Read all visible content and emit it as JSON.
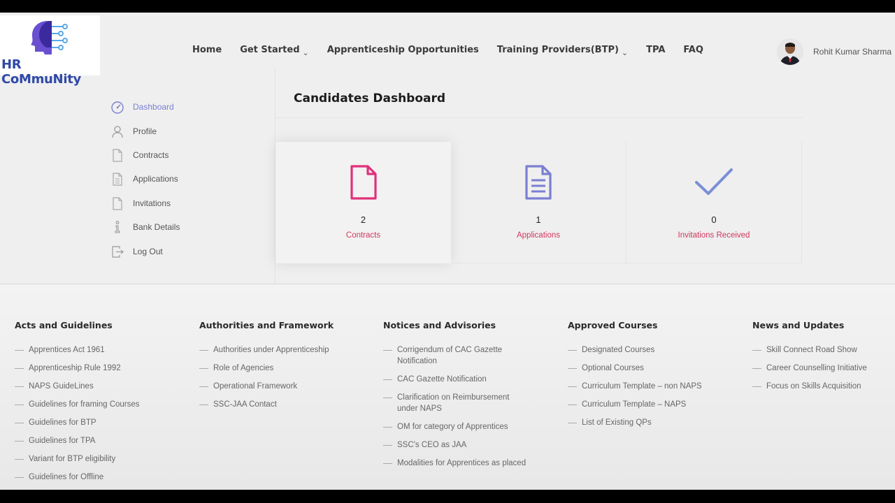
{
  "brand": {
    "name_parts": [
      {
        "text": "HR ",
        "color": "#2f49a8"
      },
      {
        "text": "CoMmuNity",
        "color": "#2f49a8"
      }
    ],
    "accent": "#5a3fc0"
  },
  "nav": {
    "items": [
      {
        "label": "Home",
        "dropdown": false
      },
      {
        "label": "Get Started",
        "dropdown": true
      },
      {
        "label": "Apprenticeship Opportunities",
        "dropdown": false
      },
      {
        "label": "Training Providers(BTP)",
        "dropdown": true
      },
      {
        "label": "TPA",
        "dropdown": false
      },
      {
        "label": "FAQ",
        "dropdown": false
      }
    ],
    "caret": "⌄"
  },
  "user": {
    "name": "Rohit Kumar Sharma"
  },
  "sidebar": {
    "items": [
      {
        "label": "Dashboard",
        "icon": "dashboard-gauge-icon",
        "active": true
      },
      {
        "label": "Profile",
        "icon": "user-icon",
        "active": false
      },
      {
        "label": "Contracts",
        "icon": "document-icon",
        "active": false
      },
      {
        "label": "Applications",
        "icon": "document-lines-icon",
        "active": false
      },
      {
        "label": "Invitations",
        "icon": "document-icon",
        "active": false
      },
      {
        "label": "Bank Details",
        "icon": "info-icon",
        "active": false
      },
      {
        "label": "Log Out",
        "icon": "logout-icon",
        "active": false
      }
    ]
  },
  "dashboard": {
    "title": "Candidates Dashboard",
    "cards": [
      {
        "count": "2",
        "label": "Contracts",
        "icon": "contract-document-icon",
        "icon_color": "#e0317b"
      },
      {
        "count": "1",
        "label": "Applications",
        "icon": "application-document-icon",
        "icon_color": "#7b7fd1"
      },
      {
        "count": "0",
        "label": "Invitations Received",
        "icon": "checkmark-icon",
        "icon_color": "#7b8fd8"
      }
    ],
    "label_color": "#d1365e"
  },
  "footer": {
    "columns": [
      {
        "heading": "Acts and Guidelines",
        "links": [
          "Apprentices Act 1961",
          "Apprenticeship Rule 1992",
          "NAPS GuideLines",
          "Guidelines for framing Courses",
          "Guidelines for BTP",
          "Guidelines for TPA",
          "Variant for BTP eligibility",
          "Guidelines for Offline"
        ]
      },
      {
        "heading": "Authorities and Framework",
        "links": [
          "Authorities under Apprenticeship",
          "Role of Agencies",
          "Operational Framework",
          "SSC-JAA Contact"
        ]
      },
      {
        "heading": "Notices and Advisories",
        "links": [
          "Corrigendum of CAC Gazette Notification",
          "CAC Gazette Notification",
          "Clarification on Reimbursement under NAPS",
          "OM for category of Apprentices",
          "SSC's CEO as JAA",
          "Modalities for Apprentices as placed"
        ]
      },
      {
        "heading": "Approved Courses",
        "links": [
          "Designated Courses",
          "Optional Courses",
          "Curriculum Template – non NAPS",
          "Curriculum Template – NAPS",
          "List of Existing QPs"
        ]
      },
      {
        "heading": "News and Updates",
        "links": [
          "Skill Connect Road Show",
          "Career Counselling Initiative",
          "Focus on Skills Acquisition"
        ]
      }
    ]
  }
}
